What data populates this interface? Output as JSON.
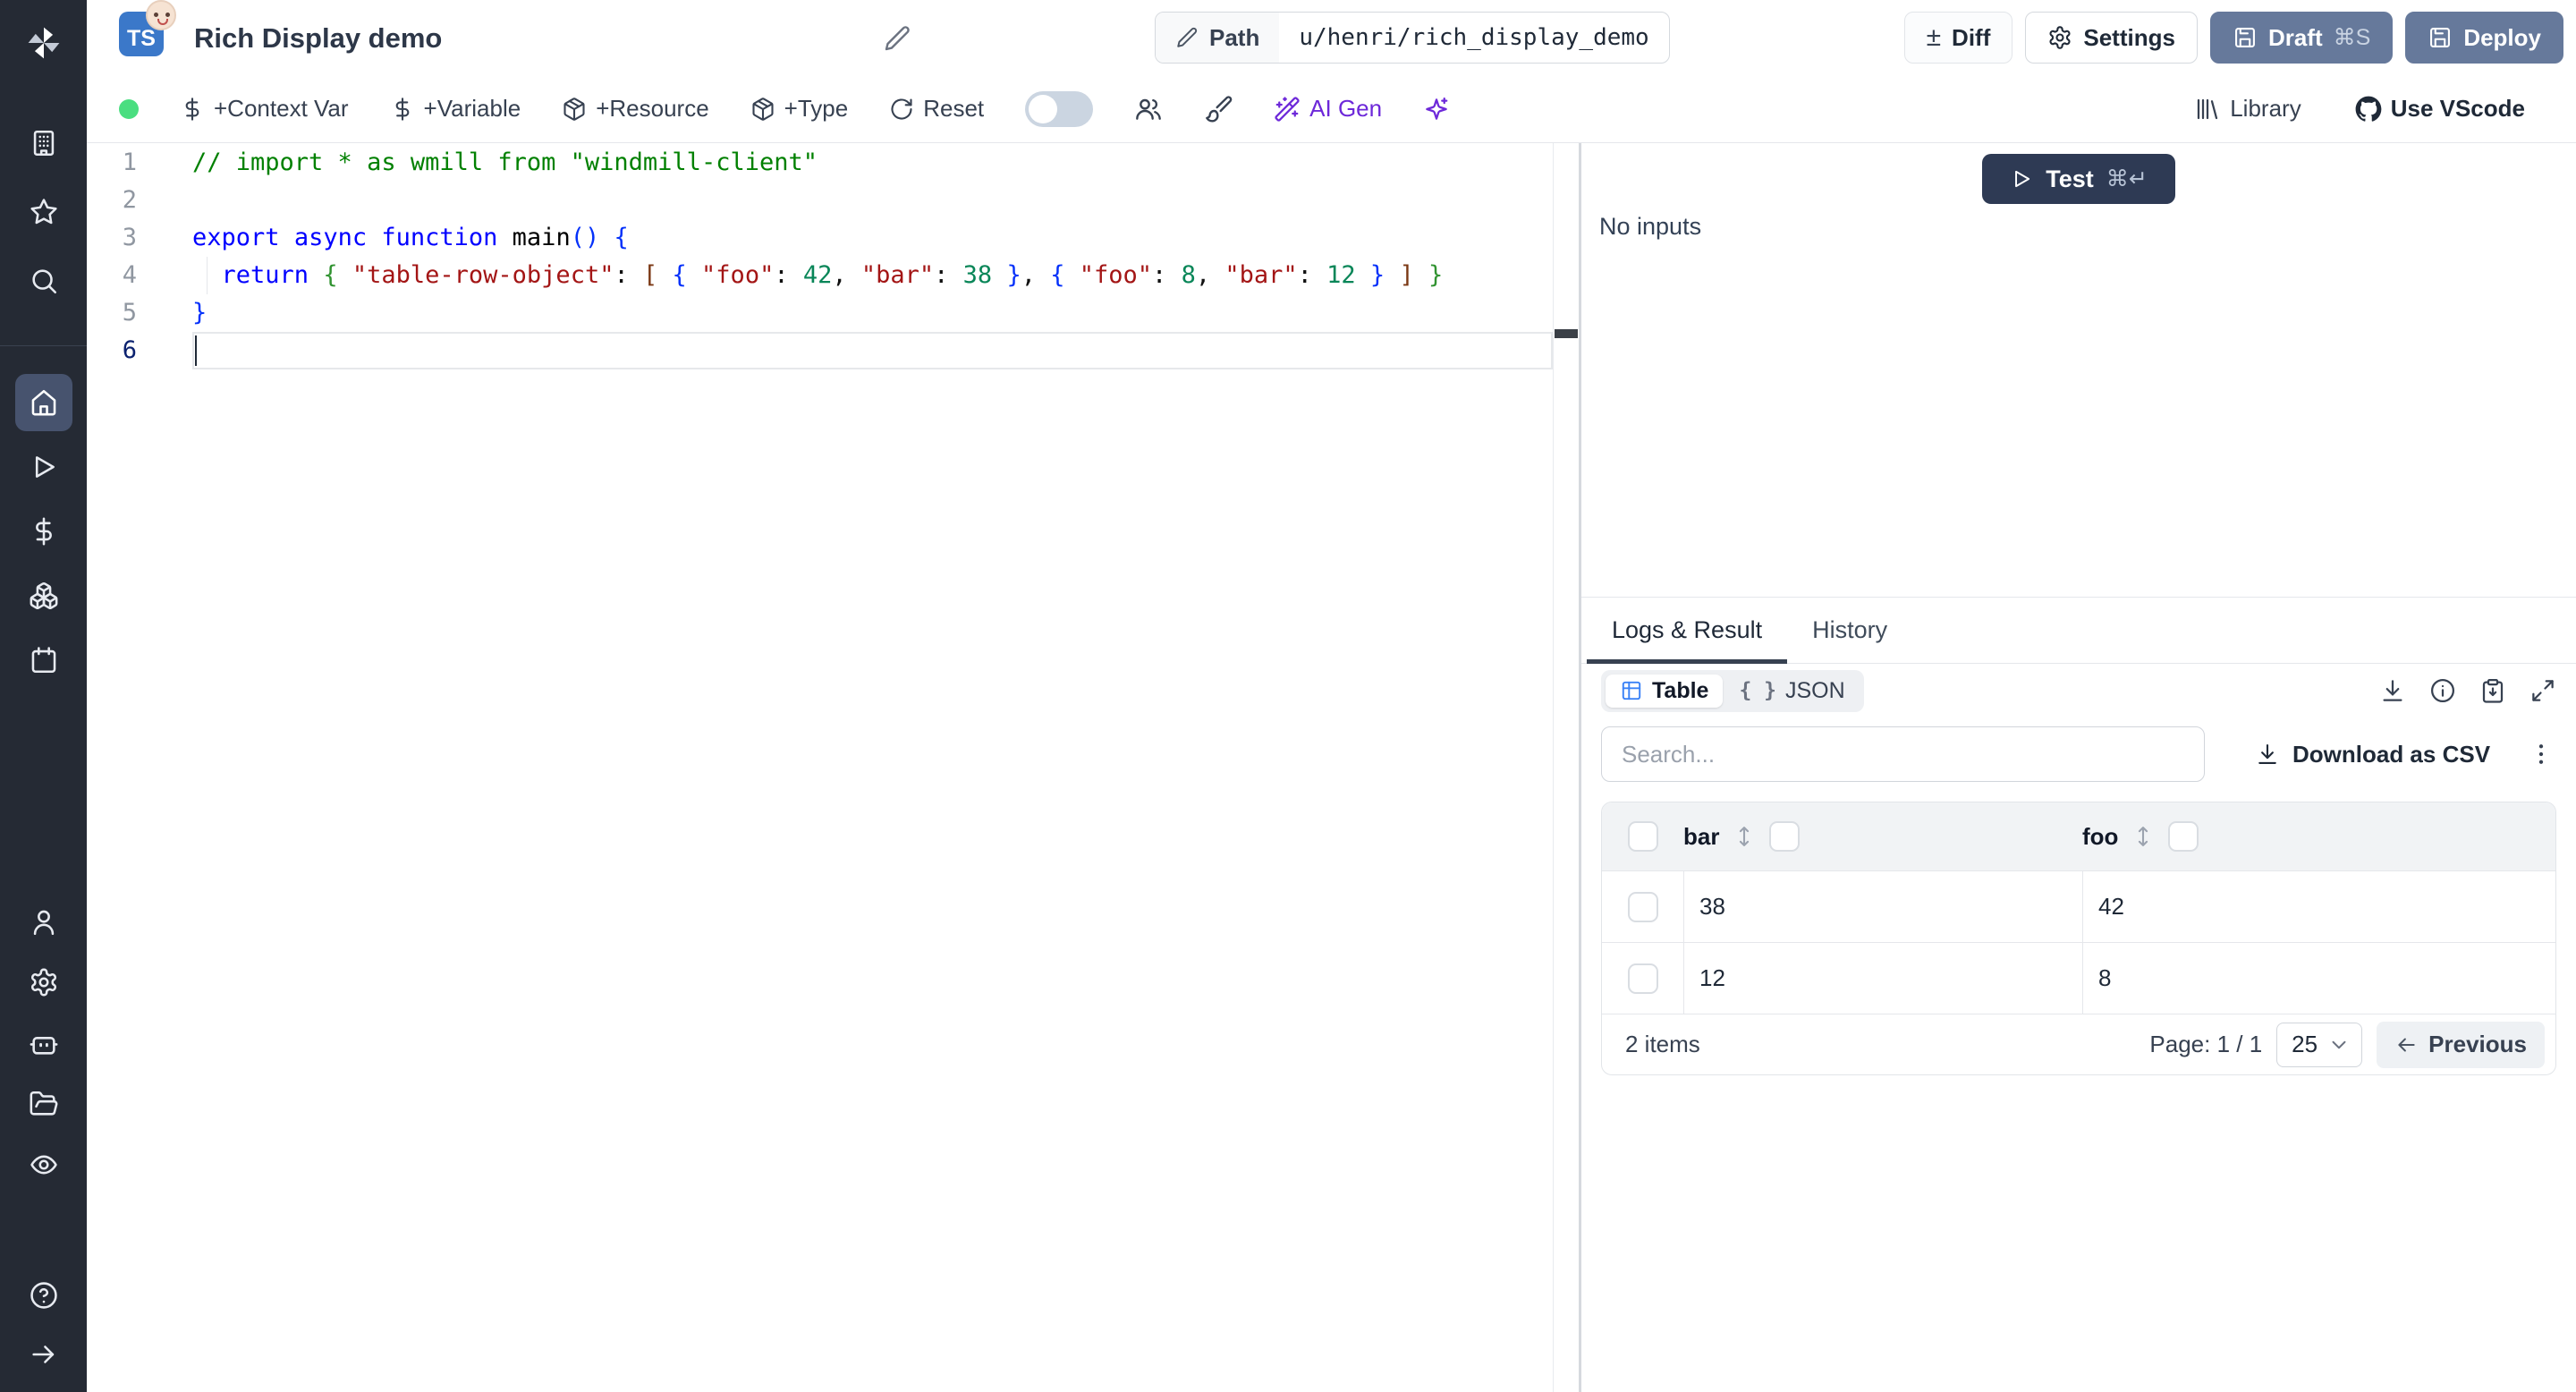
{
  "header": {
    "language_badge": "TS",
    "title": "Rich Display demo",
    "path_label": "Path",
    "path_value": "u/henri/rich_display_demo",
    "diff_label": "Diff",
    "diff_icon": "±",
    "settings_label": "Settings",
    "draft_label": "Draft",
    "draft_shortcut": "⌘S",
    "deploy_label": "Deploy"
  },
  "toolbar": {
    "context_var": "+Context Var",
    "variable": "+Variable",
    "resource": "+Resource",
    "type": "+Type",
    "reset": "Reset",
    "ai_gen": "AI Gen",
    "library": "Library",
    "use_vscode": "Use VScode"
  },
  "editor": {
    "active_line": "6",
    "lines": [
      {
        "n": "1",
        "tokens": [
          [
            "// import * as wmill from \"windmill-client\"",
            "cm"
          ]
        ]
      },
      {
        "n": "2",
        "tokens": []
      },
      {
        "n": "3",
        "tokens": [
          [
            "export",
            "kw"
          ],
          [
            " ",
            "p"
          ],
          [
            "async",
            "kw"
          ],
          [
            " ",
            "p"
          ],
          [
            "function",
            "kw"
          ],
          [
            " ",
            "p"
          ],
          [
            "main",
            "fn"
          ],
          [
            "(",
            "b1"
          ],
          [
            ")",
            "b1"
          ],
          [
            " ",
            "p"
          ],
          [
            "{",
            "b1"
          ]
        ]
      },
      {
        "n": "4",
        "tokens": [
          [
            "  ",
            "p"
          ],
          [
            "return",
            "kw"
          ],
          [
            " ",
            "p"
          ],
          [
            "{",
            "b2"
          ],
          [
            " ",
            "p"
          ],
          [
            "\"table-row-object\"",
            "str"
          ],
          [
            ": ",
            "p"
          ],
          [
            "[",
            "b3"
          ],
          [
            " ",
            "p"
          ],
          [
            "{",
            "b1"
          ],
          [
            " ",
            "p"
          ],
          [
            "\"foo\"",
            "str"
          ],
          [
            ": ",
            "p"
          ],
          [
            "42",
            "num"
          ],
          [
            ", ",
            "p"
          ],
          [
            "\"bar\"",
            "str"
          ],
          [
            ": ",
            "p"
          ],
          [
            "38",
            "num"
          ],
          [
            " ",
            "p"
          ],
          [
            "}",
            "b1"
          ],
          [
            ", ",
            "p"
          ],
          [
            "{",
            "b1"
          ],
          [
            " ",
            "p"
          ],
          [
            "\"foo\"",
            "str"
          ],
          [
            ": ",
            "p"
          ],
          [
            "8",
            "num"
          ],
          [
            ", ",
            "p"
          ],
          [
            "\"bar\"",
            "str"
          ],
          [
            ": ",
            "p"
          ],
          [
            "12",
            "num"
          ],
          [
            " ",
            "p"
          ],
          [
            "}",
            "b1"
          ],
          [
            " ",
            "p"
          ],
          [
            "]",
            "b3"
          ],
          [
            " ",
            "p"
          ],
          [
            "}",
            "b2"
          ]
        ]
      },
      {
        "n": "5",
        "tokens": [
          [
            "}",
            "b1"
          ]
        ]
      },
      {
        "n": "6",
        "tokens": []
      }
    ]
  },
  "run_panel": {
    "test_label": "Test",
    "test_shortcut": "⌘↵",
    "no_inputs": "No inputs"
  },
  "result_panel": {
    "tabs": [
      {
        "label": "Logs & Result",
        "active": true
      },
      {
        "label": "History",
        "active": false
      }
    ],
    "view_modes": [
      {
        "label": "Table",
        "active": true
      },
      {
        "label": "JSON",
        "active": false
      }
    ],
    "json_icon": "{ }",
    "search_placeholder": "Search...",
    "download_csv_label": "Download as CSV",
    "table": {
      "columns": [
        "bar",
        "foo"
      ],
      "rows": [
        {
          "bar": "38",
          "foo": "42"
        },
        {
          "bar": "12",
          "foo": "8"
        }
      ],
      "items_count": "2 items",
      "page_label": "Page: 1 / 1",
      "page_size": "25",
      "previous_label": "Previous"
    }
  },
  "colors": {
    "ts_badge_blue": "#3b78c9",
    "slate_button": "#66799b",
    "test_button": "#2e3a54",
    "ai_purple": "#6d28d9",
    "status_green": "#4ade80",
    "table_icon_blue": "#3b82f6"
  }
}
